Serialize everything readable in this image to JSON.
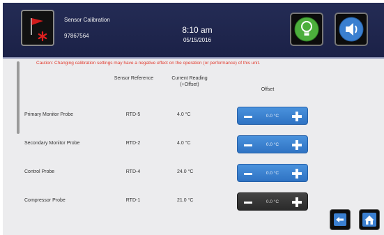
{
  "header": {
    "title": "Sensor Calibration",
    "sensor_id": "97867564",
    "time": "8:10 am",
    "date": "05/15/2016"
  },
  "caution": "Caution: Changing calibration settings may have a negative effect on the operation (or performance) of this unit.",
  "columns": {
    "sensor_reference": "Sensor Reference",
    "current_reading": "Current Reading (+Offset)",
    "offset": "Offset"
  },
  "probes": [
    {
      "name": "Primary Monitor Probe",
      "reference": "RTD-5",
      "reading": "4.0 °C",
      "offset": "0.0 °C"
    },
    {
      "name": "Secondary Monitor Probe",
      "reference": "RTD-2",
      "reading": "4.0 °C",
      "offset": "0.0 °C"
    },
    {
      "name": "Control Probe",
      "reference": "RTD-4",
      "reading": "24.0 °C",
      "offset": "0.0 °C"
    },
    {
      "name": "Compressor Probe",
      "reference": "RTD-1",
      "reading": "21.0 °C",
      "offset": "0.0 °C"
    }
  ],
  "icons": {
    "alarm": "alarm-flag-icon",
    "light": "light-bulb-icon",
    "sound": "speaker-icon",
    "back": "back-arrow-icon",
    "home": "home-icon"
  },
  "colors": {
    "header_bg": "#1f2550",
    "caution_text": "#e23b2e",
    "stepper_blue": "#3a82d0",
    "stepper_dark": "#333333",
    "bulb_green": "#4cae3c"
  }
}
